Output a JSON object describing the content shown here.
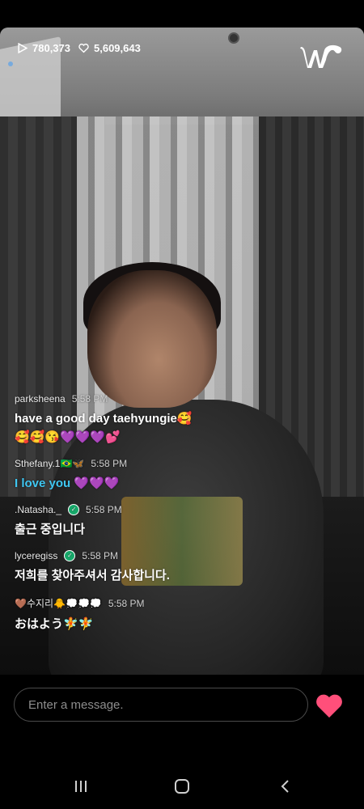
{
  "stream": {
    "views": "780,373",
    "likes": "5,609,643",
    "brand_icon": "weverse-logo"
  },
  "comments": [
    {
      "user": "parksheena",
      "time": "5:58 PM",
      "message": "have a good day taehyungie🥰",
      "extra": "🥰🥰😘💜💜💜💕",
      "style": "white"
    },
    {
      "user": "Sthefany.1🇧🇷🦋",
      "time": "5:58 PM",
      "message": "I love you 💜💜💜",
      "style": "blue"
    },
    {
      "user": ".Natasha._",
      "time": "5:58 PM",
      "message": "출근 중입니다",
      "style": "white",
      "verified": true
    },
    {
      "user": "lyceregiss",
      "time": "5:58 PM",
      "message": "저희를 찾아주셔서 감사합니다.",
      "style": "white",
      "verified": true
    },
    {
      "user": "🤎수지리🐥💭💭💭",
      "time": "5:58 PM",
      "message": "おはよう🧚🧚",
      "style": "white"
    }
  ],
  "composer": {
    "placeholder": "Enter a message.",
    "heart_color": "#ff4f7a"
  },
  "system_nav": {
    "recents_icon": "recents-icon",
    "home_icon": "home-icon",
    "back_icon": "back-icon"
  }
}
